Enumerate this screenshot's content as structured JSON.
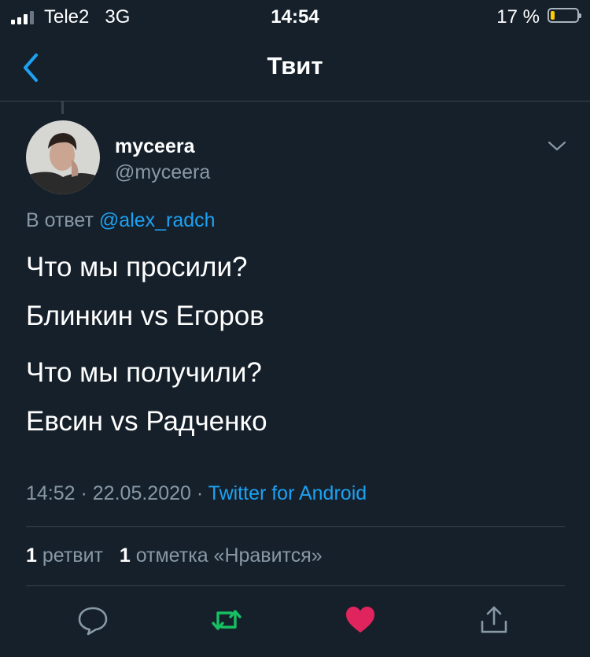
{
  "status_bar": {
    "carrier": "Tele2",
    "network": "3G",
    "time": "14:54",
    "battery_percent": "17 %",
    "battery_level": 0.17,
    "battery_color": "#ffcc00"
  },
  "nav": {
    "back_icon": "chevron-left-icon",
    "title": "Твит"
  },
  "tweet": {
    "display_name": "myceera",
    "username": "@myceera",
    "reply_prefix": "В ответ",
    "reply_mention": "@alex_radch",
    "lines": [
      "Что мы просили?",
      "Блинкин vs Егоров",
      "Что мы получили?",
      "Евсин vs Радченко"
    ],
    "time": "14:52",
    "date": "22.05.2020",
    "source": "Twitter for Android",
    "retweet_count": "1",
    "retweet_label": "ретвит",
    "like_count": "1",
    "like_label": "отметка «Нравится»"
  },
  "actions": {
    "reply_icon": "reply-bubble-icon",
    "retweet_icon": "retweet-icon",
    "like_icon": "heart-icon",
    "share_icon": "share-icon"
  },
  "colors": {
    "background": "#15202b",
    "accent": "#1da1f2",
    "muted": "#8899a6",
    "retweet": "#17bf63",
    "like": "#e0245e"
  }
}
